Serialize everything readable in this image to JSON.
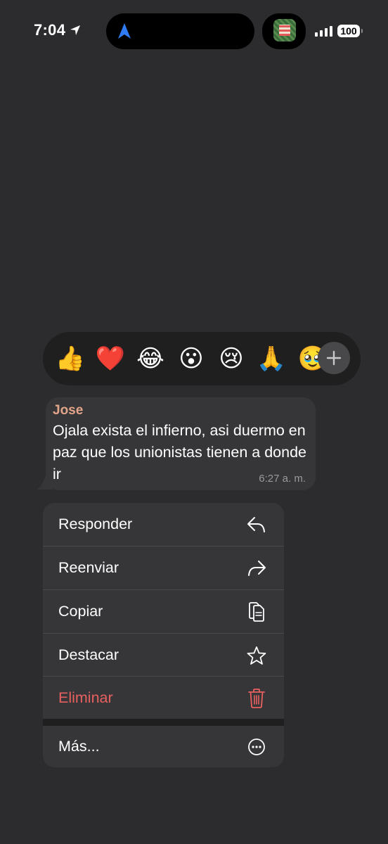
{
  "status_bar": {
    "time": "7:04",
    "battery": "100"
  },
  "reactions": {
    "items": [
      {
        "name": "thumbs-up",
        "glyph": "👍"
      },
      {
        "name": "red-heart",
        "glyph": "❤️"
      },
      {
        "name": "tears-of-joy",
        "glyph": "😂"
      },
      {
        "name": "surprised",
        "glyph": "😮"
      },
      {
        "name": "crying",
        "glyph": "😢"
      },
      {
        "name": "folded-hands",
        "glyph": "🙏"
      },
      {
        "name": "holding-back-tears",
        "glyph": "🥹"
      }
    ],
    "add_icon": "plus-icon"
  },
  "message": {
    "sender": "Jose",
    "text": "Ojala exista el infierno, asi duermo en paz que los unionistas tienen a donde ir",
    "time": "6:27 a. m.",
    "sender_color": "#e3a58a"
  },
  "menu": {
    "items": [
      {
        "label": "Responder",
        "icon": "reply-icon"
      },
      {
        "label": "Reenviar",
        "icon": "forward-icon"
      },
      {
        "label": "Copiar",
        "icon": "copy-icon"
      },
      {
        "label": "Destacar",
        "icon": "star-icon"
      },
      {
        "label": "Eliminar",
        "icon": "trash-icon",
        "danger": true
      }
    ],
    "more": {
      "label": "Más...",
      "icon": "ellipsis-circle-icon"
    },
    "danger_color": "#e8605f"
  }
}
